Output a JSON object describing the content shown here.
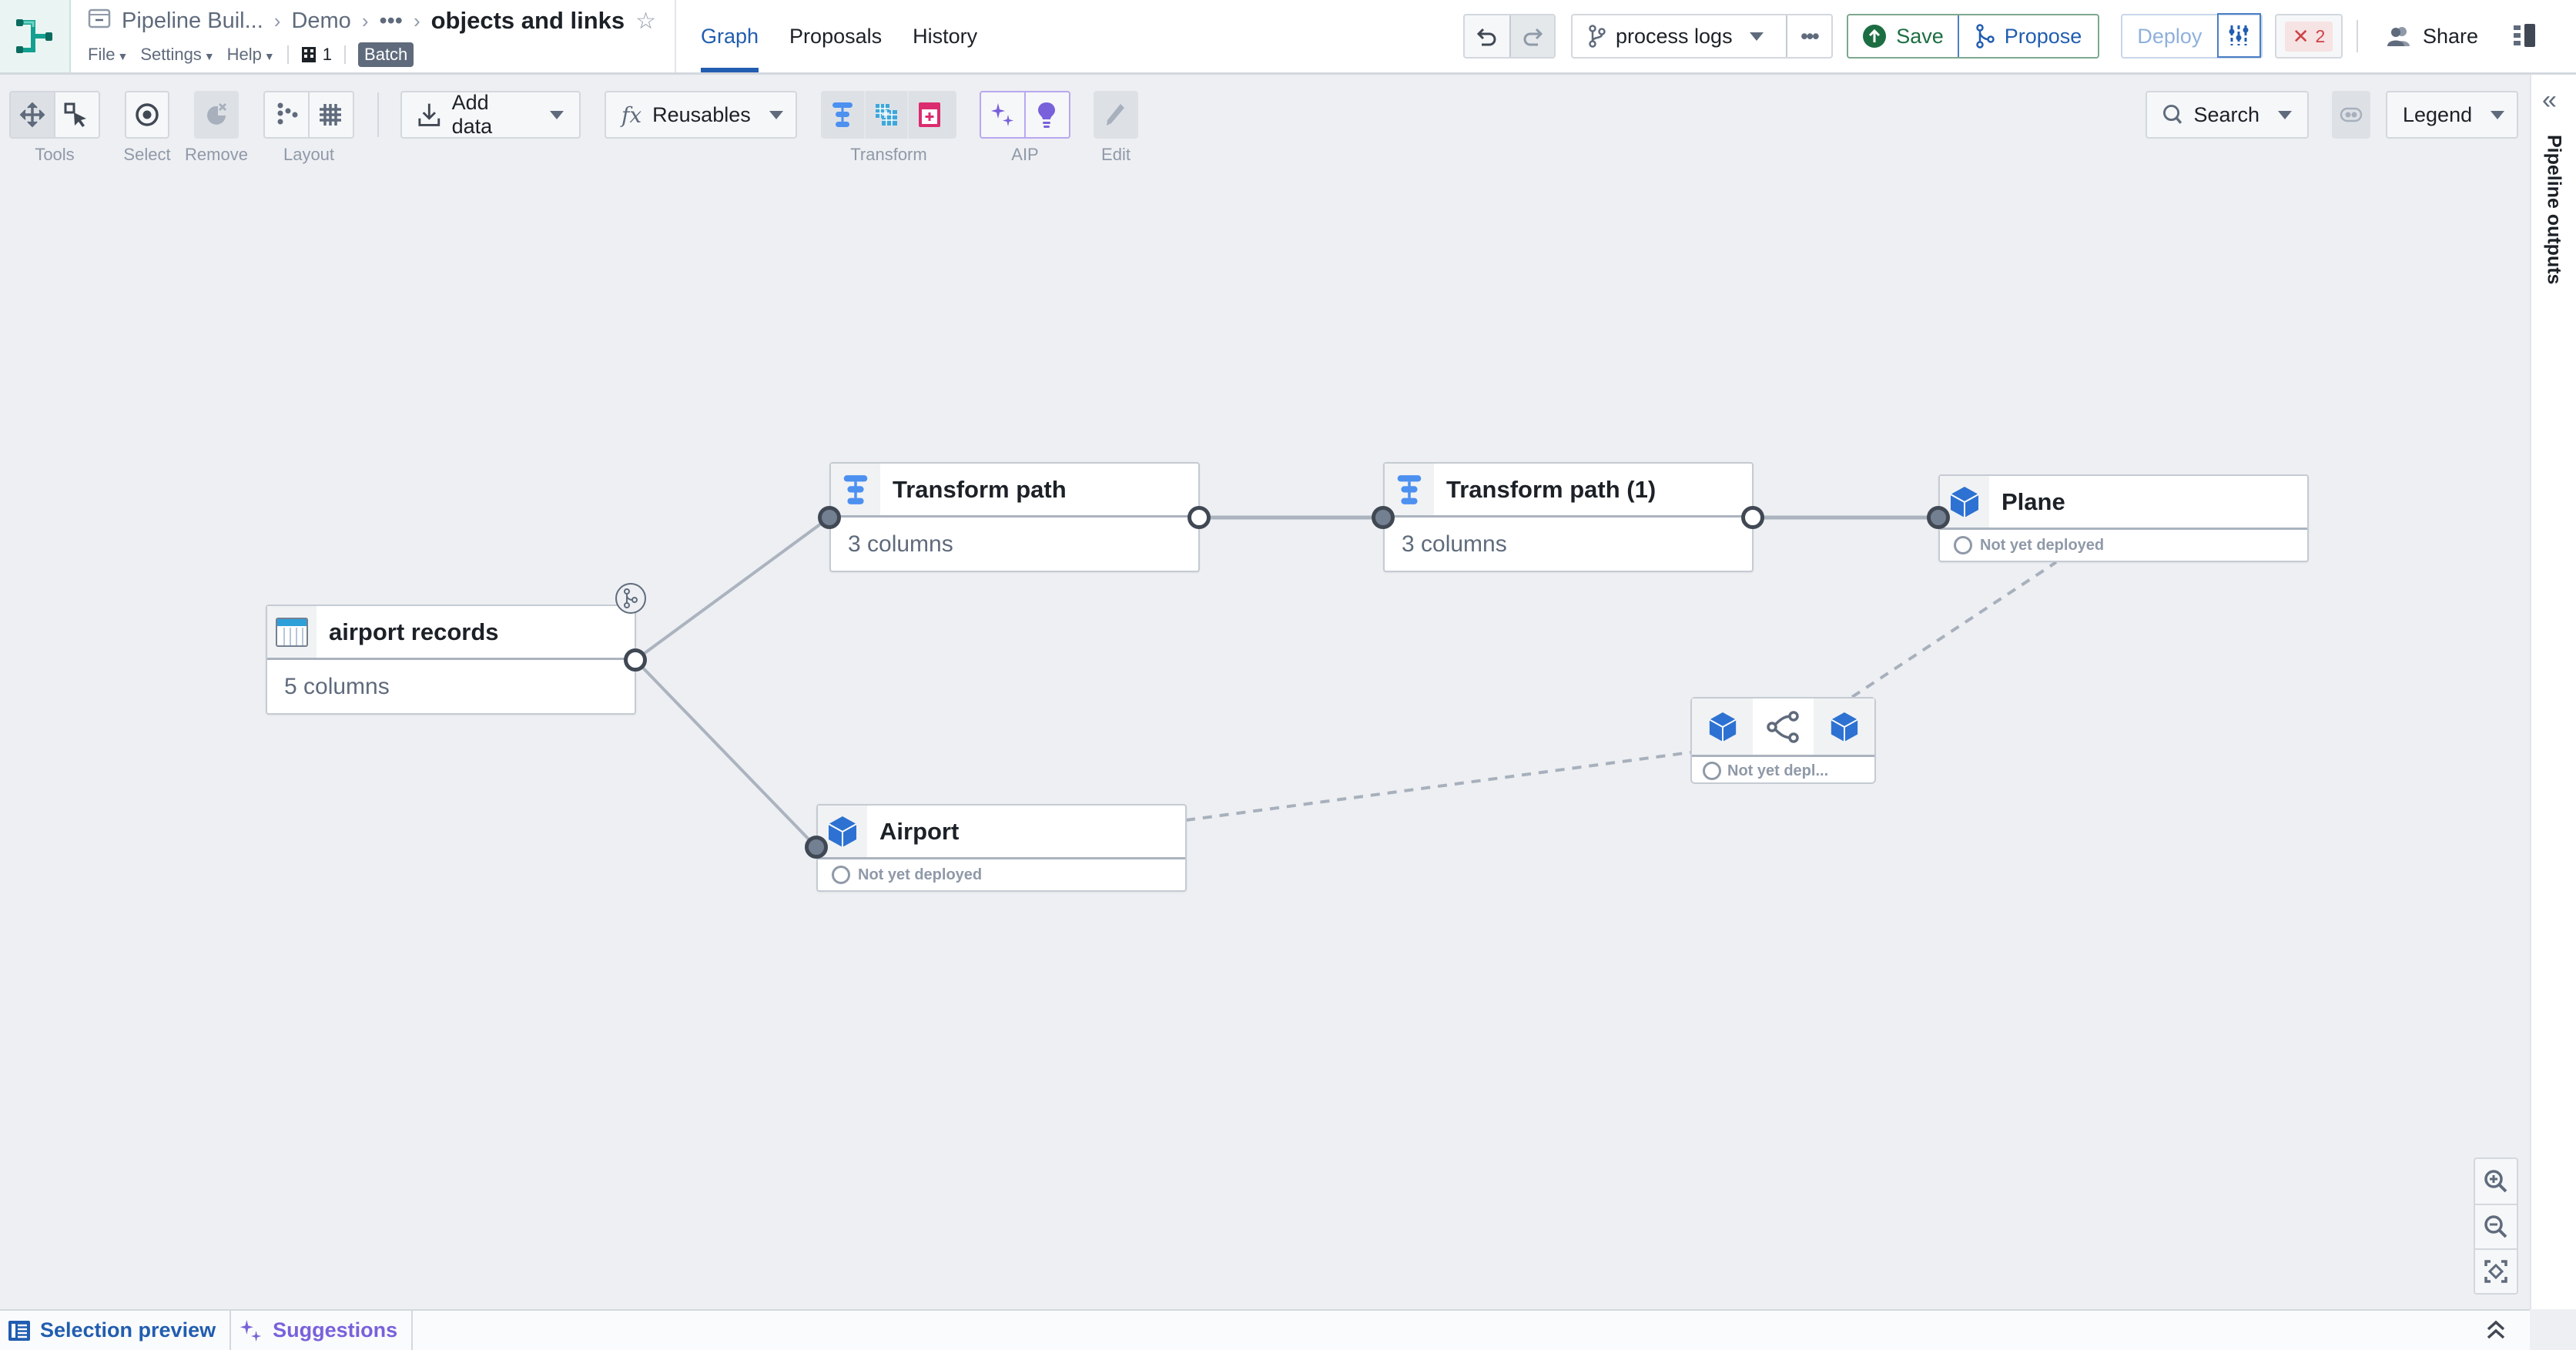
{
  "header": {
    "app_icon": "pipeline-builder-logo-icon",
    "breadcrumbs": [
      {
        "label": "Pipeline Buil...",
        "icon": "folder-icon"
      },
      {
        "label": "Demo"
      },
      {
        "label": "•••"
      },
      {
        "label": "objects and links",
        "current": true
      }
    ],
    "favorite_icon": "star-outline-icon",
    "menus": [
      "File",
      "Settings",
      "Help"
    ],
    "org_count": "1",
    "mode_badge": "Batch",
    "tabs": [
      {
        "label": "Graph",
        "active": true
      },
      {
        "label": "Proposals"
      },
      {
        "label": "History"
      }
    ],
    "branch": {
      "label": "process logs",
      "icon": "git-branch-icon"
    },
    "more_label": "•••",
    "save_label": "Save",
    "propose_label": "Propose",
    "deploy_label": "Deploy",
    "errors_count": "2",
    "share_label": "Share",
    "colors": {
      "accent": "#215db0",
      "save": "#1c6e42",
      "error": "#cd4246"
    }
  },
  "toolbar": {
    "groups": [
      {
        "label": "Tools",
        "icons": [
          "move-icon",
          "select-box-icon"
        ]
      },
      {
        "label": "Select",
        "icons": [
          "target-icon"
        ]
      },
      {
        "label": "Remove",
        "icons": [
          "remove-node-icon"
        ]
      },
      {
        "label": "Layout",
        "icons": [
          "layout-dots-icon",
          "grid-icon"
        ]
      },
      {
        "label": "Transform",
        "icons": [
          "transform-path-icon",
          "join-icon",
          "add-column-icon"
        ]
      },
      {
        "label": "AIP",
        "icons": [
          "sparkle-icon",
          "lightbulb-icon"
        ]
      },
      {
        "label": "Edit",
        "icons": [
          "pencil-icon"
        ]
      }
    ],
    "add_data_label": "Add data",
    "reusables_label": "Reusables",
    "search_label": "Search",
    "legend_label": "Legend"
  },
  "right_panel": {
    "label": "Pipeline outputs"
  },
  "graph": {
    "nodes": [
      {
        "id": "airport-records",
        "name": "airport records",
        "type": "dataset",
        "detail": "5 columns"
      },
      {
        "id": "transform-path",
        "name": "Transform path",
        "type": "transform",
        "detail": "3 columns"
      },
      {
        "id": "transform-path-1",
        "name": "Transform path (1)",
        "type": "transform",
        "detail": "3 columns"
      },
      {
        "id": "plane",
        "name": "Plane",
        "type": "object",
        "status": "Not yet deployed"
      },
      {
        "id": "airport",
        "name": "Airport",
        "type": "object",
        "status": "Not yet deployed"
      },
      {
        "id": "link",
        "name": "link",
        "type": "link",
        "status": "Not yet depl..."
      }
    ],
    "edges": [
      {
        "from": "airport-records",
        "to": "transform-path",
        "style": "solid"
      },
      {
        "from": "airport-records",
        "to": "airport",
        "style": "solid"
      },
      {
        "from": "transform-path",
        "to": "transform-path-1",
        "style": "solid"
      },
      {
        "from": "transform-path-1",
        "to": "plane",
        "style": "solid"
      },
      {
        "from": "airport",
        "to": "link",
        "style": "dashed"
      },
      {
        "from": "link",
        "to": "plane",
        "style": "dashed"
      }
    ]
  },
  "bottom": {
    "tabs": [
      {
        "label": "Selection preview",
        "icon": "table-list-icon"
      },
      {
        "label": "Suggestions",
        "icon": "sparkle-icon"
      }
    ]
  }
}
